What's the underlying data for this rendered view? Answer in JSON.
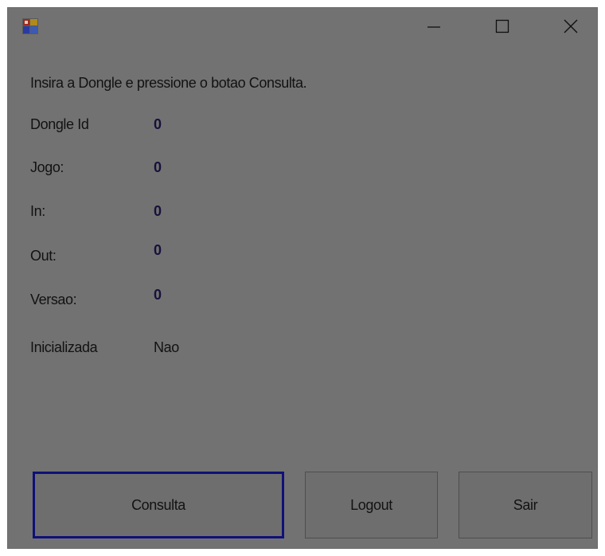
{
  "window": {
    "title": "",
    "icon": "app-icon",
    "controls": {
      "minimize": "minimize-icon",
      "maximize": "maximize-icon",
      "close": "close-icon"
    }
  },
  "instructions": "Insira a Dongle e pressione o botao Consulta.",
  "fields": [
    {
      "label": "Dongle Id",
      "value": "0"
    },
    {
      "label": "Jogo:",
      "value": "0"
    },
    {
      "label": "In:",
      "value": "0"
    },
    {
      "label": "Out:",
      "value": "0"
    },
    {
      "label": "Versao:",
      "value": "0"
    },
    {
      "label": "Inicializada",
      "value": "Nao"
    }
  ],
  "buttons": {
    "consulta": "Consulta",
    "logout": "Logout",
    "sair": "Sair"
  },
  "colors": {
    "window_bg": "#727272",
    "focus_border": "#0f1078",
    "value_text": "#17103a"
  }
}
